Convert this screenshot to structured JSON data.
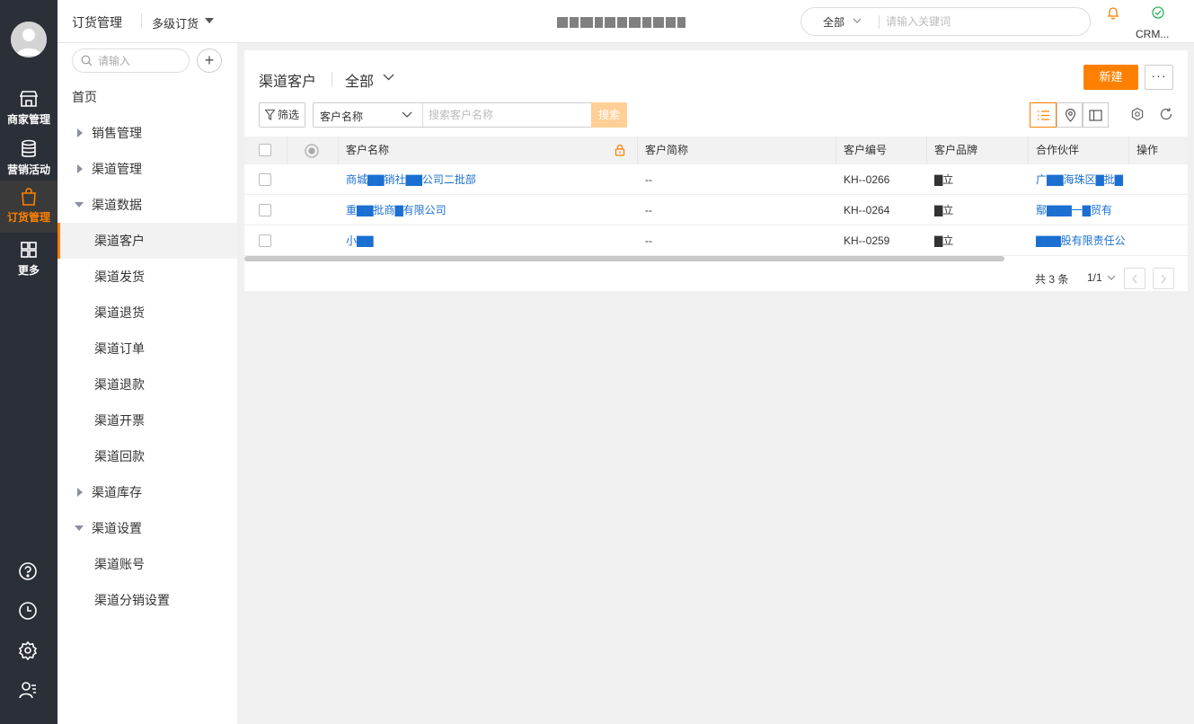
{
  "rail": {
    "items": [
      {
        "label": "商家管理",
        "icon": "store-icon"
      },
      {
        "label": "营销活动",
        "icon": "database-icon"
      },
      {
        "label": "订货管理",
        "icon": "shopping-bag-icon"
      },
      {
        "label": "更多",
        "icon": "grid-icon"
      }
    ],
    "bottom_icons": [
      "help-icon",
      "clock-icon",
      "settings-icon",
      "user-list-icon"
    ]
  },
  "topbar": {
    "app_title": "订货管理",
    "app_subtitle": "多级订货",
    "search_scope": "全部",
    "search_placeholder": "请输入关键词",
    "crm_label": "CRM..."
  },
  "subnav": {
    "search_placeholder": "请输入",
    "add_label": "+",
    "items": [
      {
        "label": "首页",
        "kind": "top"
      },
      {
        "label": "销售管理",
        "kind": "collapsed"
      },
      {
        "label": "渠道管理",
        "kind": "collapsed"
      },
      {
        "label": "渠道数据",
        "kind": "expanded"
      },
      {
        "label": "渠道客户",
        "kind": "child",
        "active": true
      },
      {
        "label": "渠道发货",
        "kind": "child"
      },
      {
        "label": "渠道退货",
        "kind": "child"
      },
      {
        "label": "渠道订单",
        "kind": "child"
      },
      {
        "label": "渠道退款",
        "kind": "child"
      },
      {
        "label": "渠道开票",
        "kind": "child"
      },
      {
        "label": "渠道回款",
        "kind": "child"
      },
      {
        "label": "渠道库存",
        "kind": "collapsed"
      },
      {
        "label": "渠道设置",
        "kind": "expanded"
      },
      {
        "label": "渠道账号",
        "kind": "child"
      },
      {
        "label": "渠道分销设置",
        "kind": "child"
      }
    ]
  },
  "main": {
    "title": "渠道客户",
    "view": "全部",
    "new_button": "新建",
    "more_button": "···",
    "filter_button": "筛选",
    "search_field": "客户名称",
    "search_placeholder": "搜索客户名称",
    "search_button": "搜索",
    "columns": [
      "客户名称",
      "客户简称",
      "客户编号",
      "客户品牌",
      "合作伙伴",
      "操作"
    ],
    "rows": [
      {
        "name": "商城▇▇销社▇▇公司二批部",
        "short": "--",
        "code": "KH--0266",
        "brand": "▇立",
        "partner": "广▇▇海珠区▇批▇"
      },
      {
        "name": "重▇▇批商▇有限公司",
        "short": "--",
        "code": "KH--0264",
        "brand": "▇立",
        "partner": "鄢▇▇▇一▇贸有"
      },
      {
        "name": "小▇▇",
        "short": "--",
        "code": "KH--0259",
        "brand": "▇立",
        "partner": "▇▇▇股有限责任公"
      }
    ],
    "pager": {
      "total": "共 3 条",
      "page": "1/1"
    }
  },
  "colors": {
    "accent": "#ff8000",
    "rail": "#2b2f38",
    "link": "#1a6fd1"
  }
}
